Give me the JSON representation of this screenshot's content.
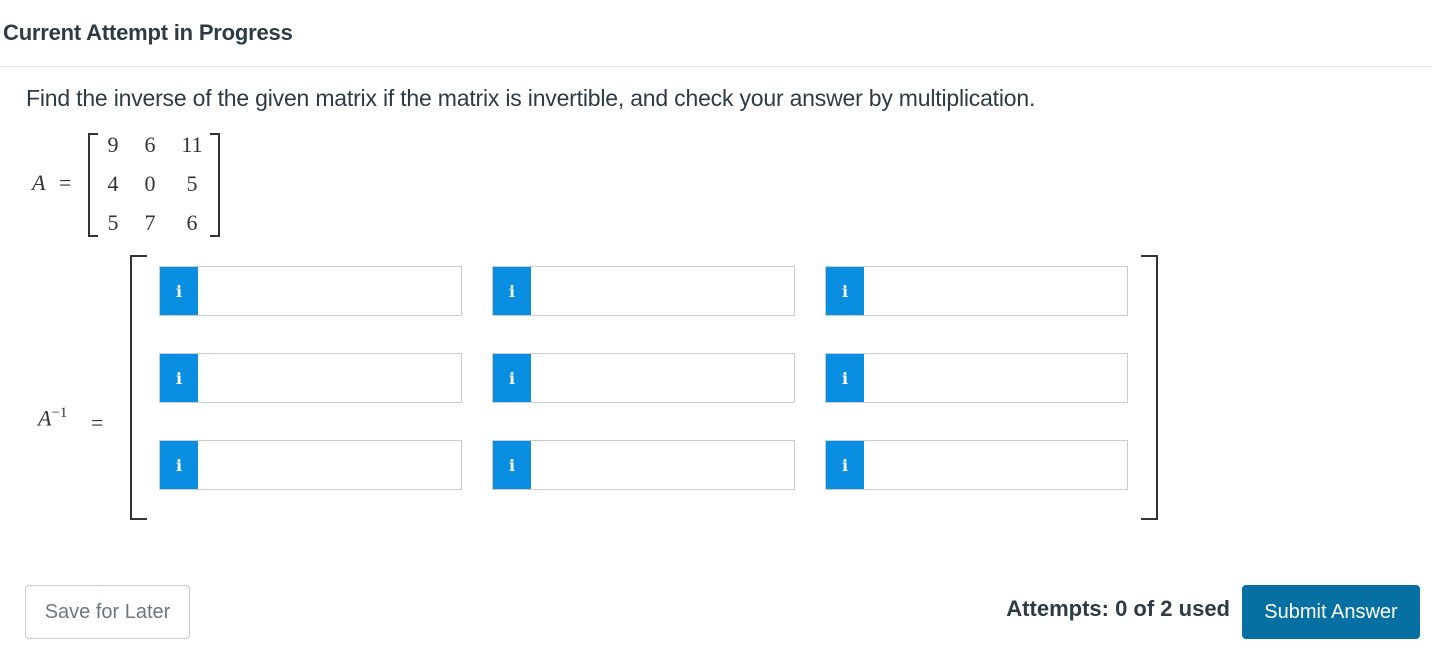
{
  "header": {
    "title": "Current Attempt in Progress"
  },
  "question": {
    "text": "Find the inverse of the given matrix if the matrix is invertible, and check your answer by multiplication."
  },
  "matrix_a": {
    "label_var": "A",
    "label_eq": "=",
    "rows": [
      [
        "9",
        "6",
        "11"
      ],
      [
        "4",
        "0",
        "5"
      ],
      [
        "5",
        "7",
        "6"
      ]
    ]
  },
  "inverse": {
    "label_var": "A",
    "label_sup": "−1",
    "label_eq": "=",
    "icon_glyph": "i",
    "icon_name": "info-icon",
    "answers": [
      [
        "",
        "",
        ""
      ],
      [
        "",
        "",
        ""
      ],
      [
        "",
        "",
        ""
      ]
    ]
  },
  "footer": {
    "save_label": "Save for Later",
    "attempts_text": "Attempts: 0 of 2 used",
    "submit_label": "Submit Answer"
  },
  "colors": {
    "accent": "#0770a3",
    "info_icon": "#0a8ee2",
    "text": "#2d3b45"
  }
}
